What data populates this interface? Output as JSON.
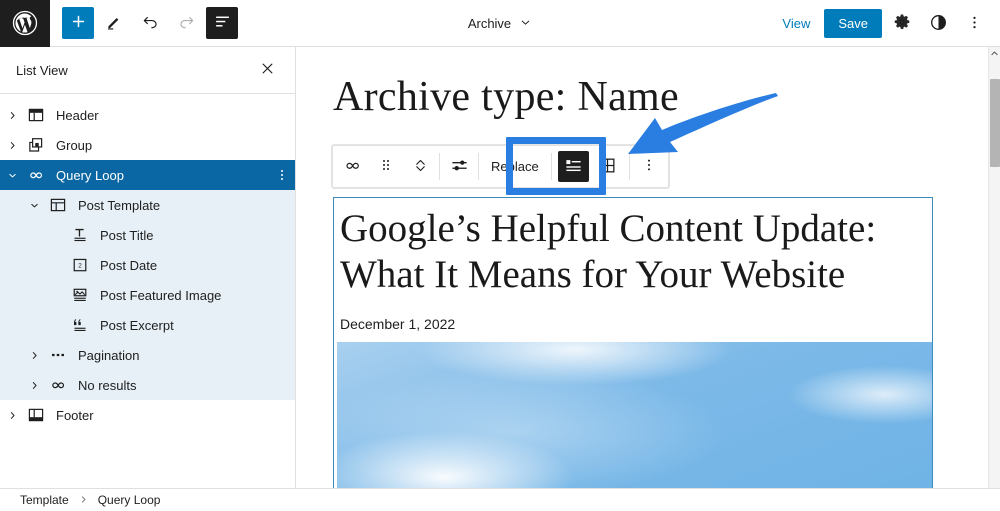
{
  "topbar": {
    "logo_icon": "wordpress-logo-icon",
    "add_block_label": "+",
    "add_block_icon": "plus-icon",
    "tools_icon": "pencil-edit-icon",
    "undo_icon": "undo-arrow-icon",
    "redo_icon": "redo-arrow-icon",
    "listview_icon": "list-view-icon",
    "document_title": "Archive",
    "document_chevron_icon": "chevron-down-icon",
    "view_label": "View",
    "save_label": "Save",
    "settings_icon": "gear-icon",
    "styles_icon": "contrast-half-circle-icon",
    "options_icon": "three-dots-vertical-icon"
  },
  "sidebar": {
    "title": "List View",
    "close_icon": "close-x-icon",
    "items": [
      {
        "label": "Header",
        "icon": "header-block-icon",
        "depth": 0,
        "chevron": "right",
        "state": "normal"
      },
      {
        "label": "Group",
        "icon": "group-block-icon",
        "depth": 0,
        "chevron": "right",
        "state": "normal"
      },
      {
        "label": "Query Loop",
        "icon": "query-loop-block-icon",
        "depth": 0,
        "chevron": "down",
        "state": "selected",
        "more_icon": "three-dots-vertical-icon"
      },
      {
        "label": "Post Template",
        "icon": "post-template-block-icon",
        "depth": 1,
        "chevron": "down",
        "state": "branch"
      },
      {
        "label": "Post Title",
        "icon": "post-title-block-icon",
        "depth": 2,
        "chevron": "none",
        "state": "branch"
      },
      {
        "label": "Post Date",
        "icon": "post-date-block-icon",
        "depth": 2,
        "chevron": "none",
        "state": "branch"
      },
      {
        "label": "Post Featured Image",
        "icon": "featured-image-block-icon",
        "depth": 2,
        "chevron": "none",
        "state": "branch"
      },
      {
        "label": "Post Excerpt",
        "icon": "post-excerpt-block-icon",
        "depth": 2,
        "chevron": "none",
        "state": "branch"
      },
      {
        "label": "Pagination",
        "icon": "pagination-block-icon",
        "depth": 1,
        "chevron": "right",
        "state": "branch"
      },
      {
        "label": "No results",
        "icon": "query-loop-block-icon",
        "depth": 1,
        "chevron": "right",
        "state": "branch"
      },
      {
        "label": "Footer",
        "icon": "footer-block-icon",
        "depth": 0,
        "chevron": "right",
        "state": "normal"
      }
    ]
  },
  "block_toolbar": {
    "block_type_icon": "query-loop-block-icon",
    "drag_handle_icon": "drag-handle-dots-icon",
    "move_updown_icon": "move-up-down-chevrons-icon",
    "display_settings_icon": "sliders-settings-icon",
    "replace_label": "Replace",
    "list_view_icon": "layout-list-icon",
    "grid_view_icon": "layout-grid-icon",
    "active_layout": "list",
    "more_options_icon": "three-dots-vertical-icon"
  },
  "canvas": {
    "page_heading": "Archive type: Name",
    "post_title": "Google’s Helpful Content Update: What It Means for Your Website",
    "post_date": "December 1, 2022",
    "featured_image_alt": "sky-with-clouds-photo"
  },
  "annotation": {
    "highlight_color": "#2a7de1",
    "arrow_icon": "pointer-arrow-icon",
    "target": "layout-toggle-buttons"
  },
  "scrollbar": {
    "up_arrow_icon": "chevron-up-icon",
    "thumb_name": "vertical-scroll-thumb"
  },
  "breadcrumb": {
    "items": [
      "Template",
      "Query Loop"
    ],
    "separator_icon": "chevron-right-icon"
  },
  "colors": {
    "wp_blue": "#007cba",
    "selected_row": "#0a67a3",
    "branch_row": "#e7f0f6",
    "annotation_blue": "#2a7de1",
    "dark": "#1e1e1e"
  }
}
